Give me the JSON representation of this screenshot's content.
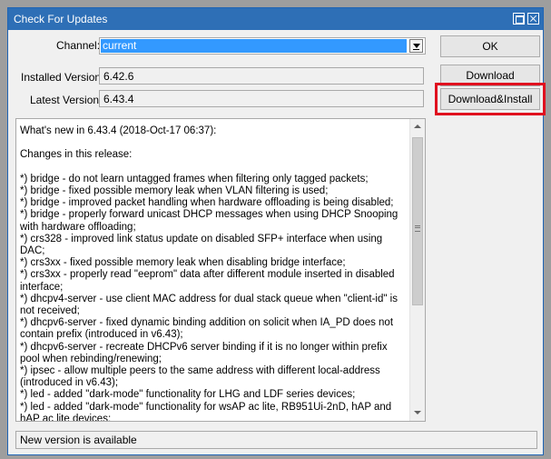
{
  "window": {
    "title": "Check For Updates"
  },
  "form": {
    "channel_label": "Channel:",
    "channel_value": "current",
    "installed_label": "Installed Version:",
    "installed_value": "6.42.6",
    "latest_label": "Latest Version:",
    "latest_value": "6.43.4"
  },
  "buttons": {
    "ok": "OK",
    "download": "Download",
    "download_install": "Download&Install"
  },
  "changelog": {
    "text": "What's new in 6.43.4 (2018-Oct-17 06:37):\n\nChanges in this release:\n\n*) bridge - do not learn untagged frames when filtering only tagged packets;\n*) bridge - fixed possible memory leak when VLAN filtering is used;\n*) bridge - improved packet handling when hardware offloading is being disabled;\n*) bridge - properly forward unicast DHCP messages when using DHCP Snooping with hardware offloading;\n*) crs328 - improved link status update on disabled SFP+ interface when using DAC;\n*) crs3xx - fixed possible memory leak when disabling bridge interface;\n*) crs3xx - properly read \"eeprom\" data after different module inserted in disabled interface;\n*) dhcpv4-server - use client MAC address for dual stack queue when \"client-id\" is not received;\n*) dhcpv6-server - fixed dynamic binding addition on solicit when IA_PD does not contain prefix (introduced in v6.43);\n*) dhcpv6-server - recreate DHCPv6 server binding if it is no longer within prefix pool when rebinding/renewing;\n*) ipsec - allow multiple peers to the same address with different local-address (introduced in v6.43);\n*) led - added \"dark-mode\" functionality for LHG and LDF series devices;\n*) led - added \"dark-mode\" functionality for wsAP ac lite, RB951Ui-2nD, hAP and hAP ac lite devices;\n*) led - fixed default LED configuration for SXT LTE kit devices;\n*) led - fixed power LED turning on after reboot when \"dark-mode\" is used;"
  },
  "status": {
    "text": "New version is available"
  },
  "colors": {
    "titlebar": "#2e6fb6",
    "selection": "#3399ff",
    "highlight": "#e0111f"
  }
}
